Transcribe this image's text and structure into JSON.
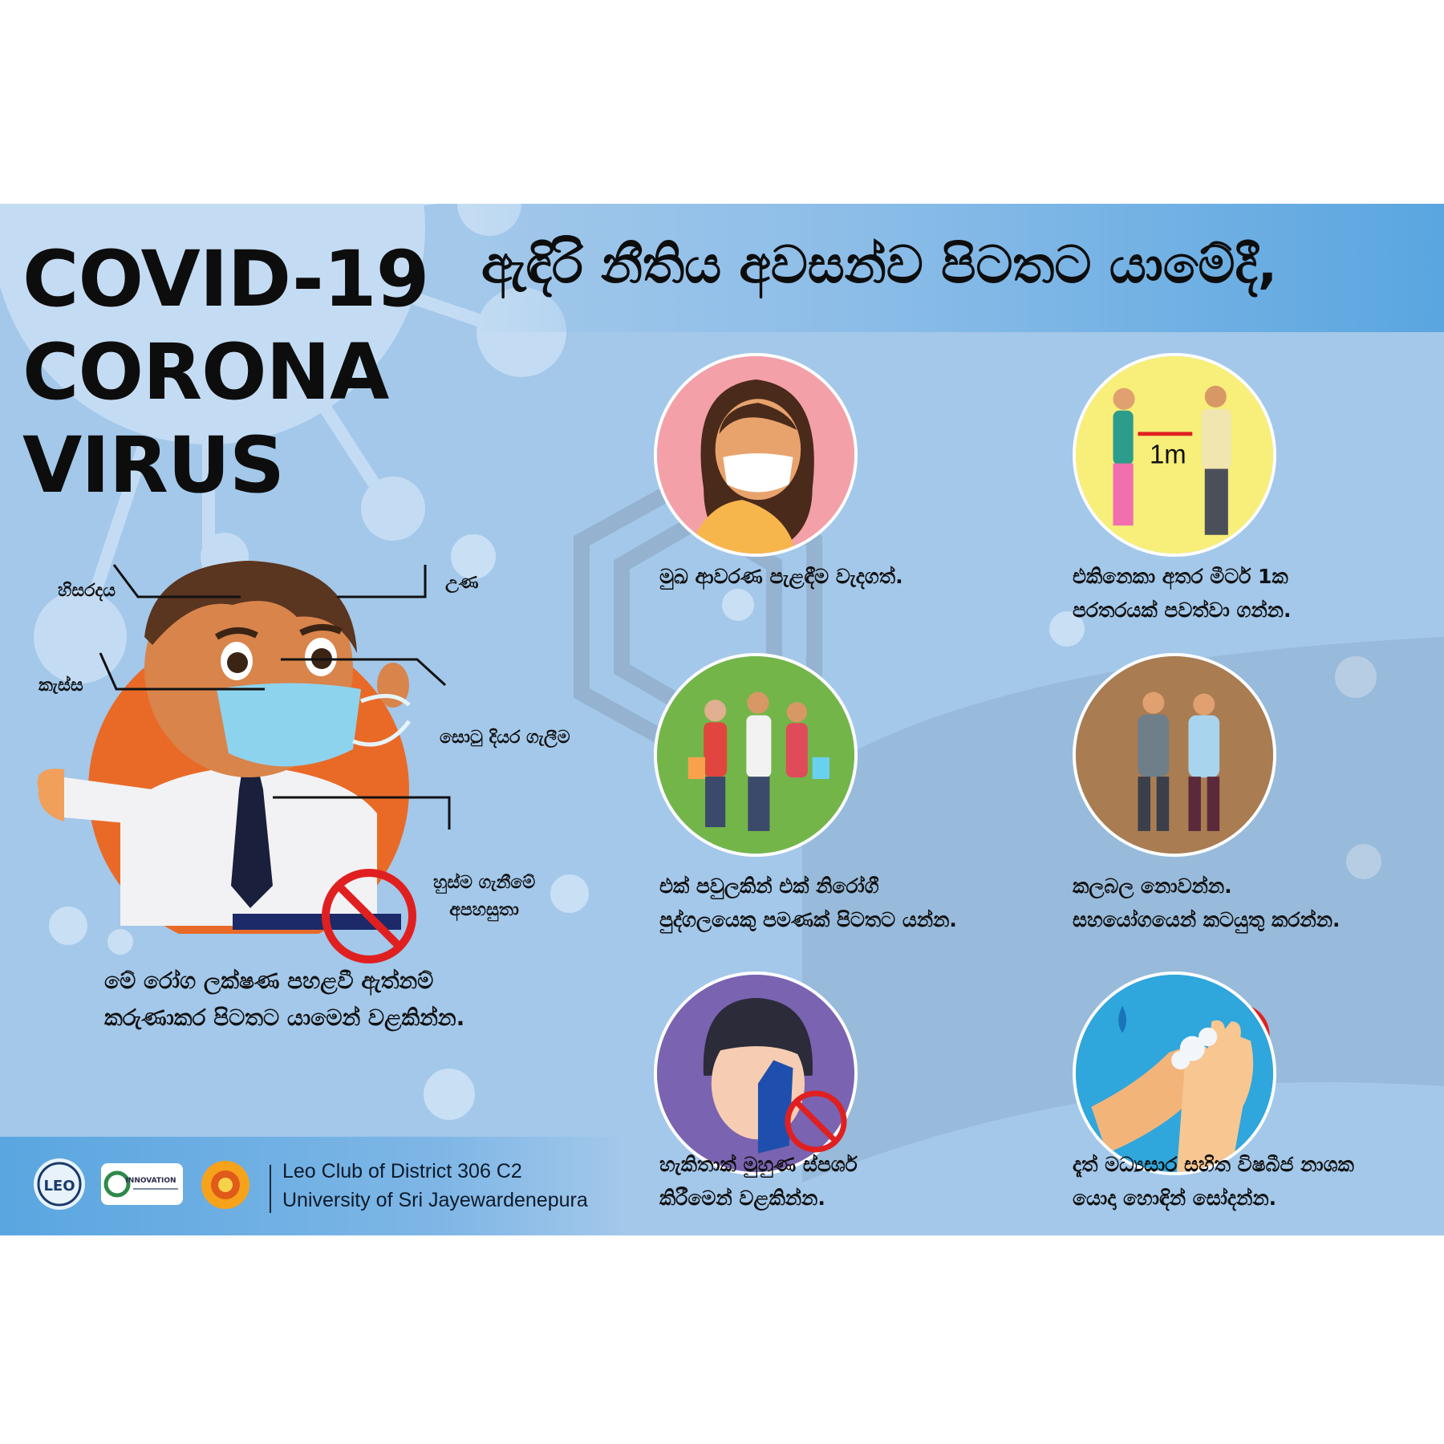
{
  "title": {
    "line1": "COVID-19",
    "line2": "CORONA",
    "line3": "VIRUS"
  },
  "headline": "ඇඳිරි නීතිය අවසන්ව පිටතට යාමේදී,",
  "symptoms": {
    "headache": "හිසරදය",
    "fever": "උණ",
    "cough": "කැස්ස",
    "runny_nose": "සොටු දියර ගැලීම",
    "breathing_line1": "හුස්ම ගැනීමේ",
    "breathing_line2": "අපහසුතා"
  },
  "main_caption": {
    "line1": "මේ රෝග ලක්ෂණ පහළවී ඇත්නම්",
    "line2": "කරුණාකර පිටතට යාමෙන් වළකින්න."
  },
  "tips": [
    {
      "line1": "මුඛ ආවරණ පැළඳීම වැදගත්.",
      "line2": ""
    },
    {
      "line1": "එකිනෙකා අතර මීටර් 1ක",
      "line2": "පරතරයක් පවත්වා ගන්න."
    },
    {
      "line1": "එක් පවුලකින් එක් නිරෝගී",
      "line2": "පුද්ගලයෙකු පමණක් පිටතට යන්න."
    },
    {
      "line1": "කලබල නොවන්න.",
      "line2": "සහයෝගයෙන් කටයුතු කරන්න."
    },
    {
      "line1": "හැකිතාක් මුහුණ ස්පර්ශ",
      "line2": "කිරීමෙන් වළකින්න."
    },
    {
      "line1": "දෑත් මධ්‍යසාර සහිත විෂබීජ නාශක",
      "line2": "යොදා හොඳින් සෝදන්න."
    }
  ],
  "distance_label": "1m",
  "footer": {
    "line1": "Leo Club of District 306 C2",
    "line2": "University of Sri Jayewardenepura",
    "logo_text": "LEO",
    "innovation_text": "INNOVATION"
  },
  "colors": {
    "background": "#a3c8ea",
    "accent_blue": "#5aa6e0",
    "forbidden_red": "#e02020",
    "mask_circle": "#f4a0a8",
    "distance_circle": "#f7ef7a",
    "family_circle": "#74b54a",
    "calm_circle": "#a97c52",
    "touch_circle": "#7a63b0",
    "wash_circle": "#2fa6dc",
    "man_circle": "#e96a27"
  }
}
